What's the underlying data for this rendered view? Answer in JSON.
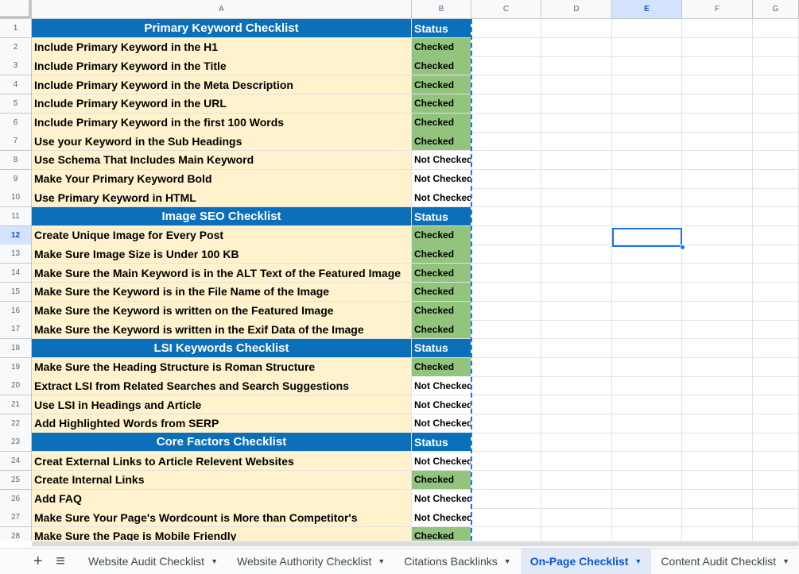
{
  "columns": [
    "A",
    "B",
    "C",
    "D",
    "E",
    "F",
    "G"
  ],
  "selected_column": "E",
  "selected_row": "12",
  "rows": [
    {
      "n": "1",
      "a": "Primary Keyword Checklist",
      "b": "Status",
      "kind": "hdr"
    },
    {
      "n": "2",
      "a": "Include Primary Keyword in the H1",
      "b": "Checked",
      "kind": "checked"
    },
    {
      "n": "3",
      "a": "Include Primary Keyword in the Title",
      "b": "Checked",
      "kind": "checked"
    },
    {
      "n": "4",
      "a": "Include Primary Keyword in the Meta Description",
      "b": "Checked",
      "kind": "checked"
    },
    {
      "n": "5",
      "a": "Include Primary Keyword in the URL",
      "b": "Checked",
      "kind": "checked"
    },
    {
      "n": "6",
      "a": "Include Primary Keyword in the first 100 Words",
      "b": "Checked",
      "kind": "checked"
    },
    {
      "n": "7",
      "a": "Use your Keyword in the Sub Headings",
      "b": "Checked",
      "kind": "checked"
    },
    {
      "n": "8",
      "a": "Use Schema That Includes Main Keyword",
      "b": "Not Checked",
      "kind": "notchecked"
    },
    {
      "n": "9",
      "a": "Make Your Primary Keyword Bold",
      "b": "Not Checked",
      "kind": "notchecked"
    },
    {
      "n": "10",
      "a": "Use Primary Keyword in HTML",
      "b": "Not Checked",
      "kind": "notchecked"
    },
    {
      "n": "11",
      "a": "Image SEO Checklist",
      "b": "Status",
      "kind": "hdr"
    },
    {
      "n": "12",
      "a": "Create Unique Image for Every Post",
      "b": "Checked",
      "kind": "checked"
    },
    {
      "n": "13",
      "a": "Make Sure Image Size is Under 100 KB",
      "b": "Checked",
      "kind": "checked"
    },
    {
      "n": "14",
      "a": "Make Sure the Main Keyword is in the ALT Text of the Featured Image",
      "b": "Checked",
      "kind": "checked"
    },
    {
      "n": "15",
      "a": "Make Sure the Keyword is in the File Name of the Image",
      "b": "Checked",
      "kind": "checked"
    },
    {
      "n": "16",
      "a": "Make Sure the Keyword is written on the Featured Image",
      "b": "Checked",
      "kind": "checked"
    },
    {
      "n": "17",
      "a": "Make Sure the Keyword is written in the Exif Data of the Image",
      "b": "Checked",
      "kind": "checked"
    },
    {
      "n": "18",
      "a": "LSI Keywords Checklist",
      "b": "Status",
      "kind": "hdr"
    },
    {
      "n": "19",
      "a": "Make Sure the Heading Structure is Roman Structure",
      "b": "Checked",
      "kind": "checked"
    },
    {
      "n": "20",
      "a": "Extract LSI from Related Searches and Search Suggestions",
      "b": "Not Checked",
      "kind": "notchecked"
    },
    {
      "n": "21",
      "a": "Use LSI in Headings and Article",
      "b": "Not Checked",
      "kind": "notchecked"
    },
    {
      "n": "22",
      "a": "Add Highlighted Words from SERP",
      "b": "Not Checked",
      "kind": "notchecked"
    },
    {
      "n": "23",
      "a": "Core Factors Checklist",
      "b": "Status",
      "kind": "hdr"
    },
    {
      "n": "24",
      "a": "Creat External Links to Article Relevent Websites",
      "b": "Not Checked",
      "kind": "notchecked"
    },
    {
      "n": "25",
      "a": "Create Internal Links",
      "b": "Checked",
      "kind": "checked"
    },
    {
      "n": "26",
      "a": "Add FAQ",
      "b": "Not Checked",
      "kind": "notchecked"
    },
    {
      "n": "27",
      "a": "Make Sure Your Page's Wordcount is More than Competitor's",
      "b": "Not Checked",
      "kind": "notchecked"
    },
    {
      "n": "28",
      "a": "Make Sure the Page is Mobile Friendly",
      "b": "Checked",
      "kind": "checked"
    }
  ],
  "sheet_tabs": [
    {
      "label": "Website Audit Checklist",
      "active": false
    },
    {
      "label": "Website Authority Checklist",
      "active": false
    },
    {
      "label": "Citations Backlinks",
      "active": false
    },
    {
      "label": "On-Page Checklist",
      "active": true
    },
    {
      "label": "Content Audit Checklist",
      "active": false
    }
  ],
  "toolbar": {
    "add_icon": "+",
    "list_icon": "≡",
    "caret": "▼"
  },
  "colors": {
    "header_blue": "#0b6fba",
    "checked_green": "#93c47d",
    "item_yellow": "#fff2cc",
    "accent": "#1a73e8"
  }
}
